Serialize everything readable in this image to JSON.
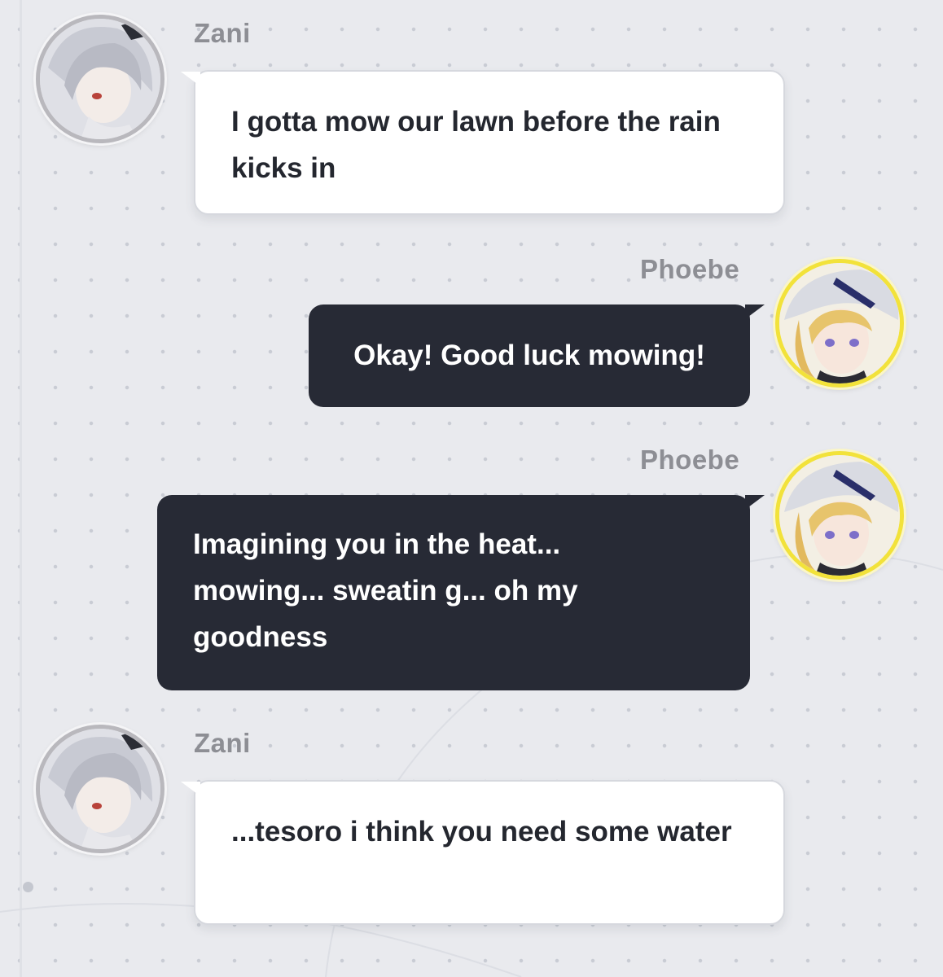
{
  "messages": [
    {
      "sender": "Zani",
      "side": "left",
      "text": "I gotta mow our lawn before the rain kicks in"
    },
    {
      "sender": "Phoebe",
      "side": "right",
      "text": "Okay! Good luck mowing!"
    },
    {
      "sender": "Phoebe",
      "side": "right",
      "text": "Imagining you in the heat... mowing... sweatin g... oh my goodness"
    },
    {
      "sender": "Zani",
      "side": "left",
      "text": "...tesoro i think you need some water"
    }
  ],
  "avatars": {
    "zani": {
      "icon": "zani-avatar-icon",
      "ring_color": "#b9b8bd"
    },
    "phoebe": {
      "icon": "phoebe-avatar-icon",
      "ring_color": "#f2e23a"
    }
  },
  "colors": {
    "background": "#e9eaee",
    "incoming_bubble": "#ffffff",
    "outgoing_bubble": "#272a35",
    "name_text": "#8d8e94"
  }
}
